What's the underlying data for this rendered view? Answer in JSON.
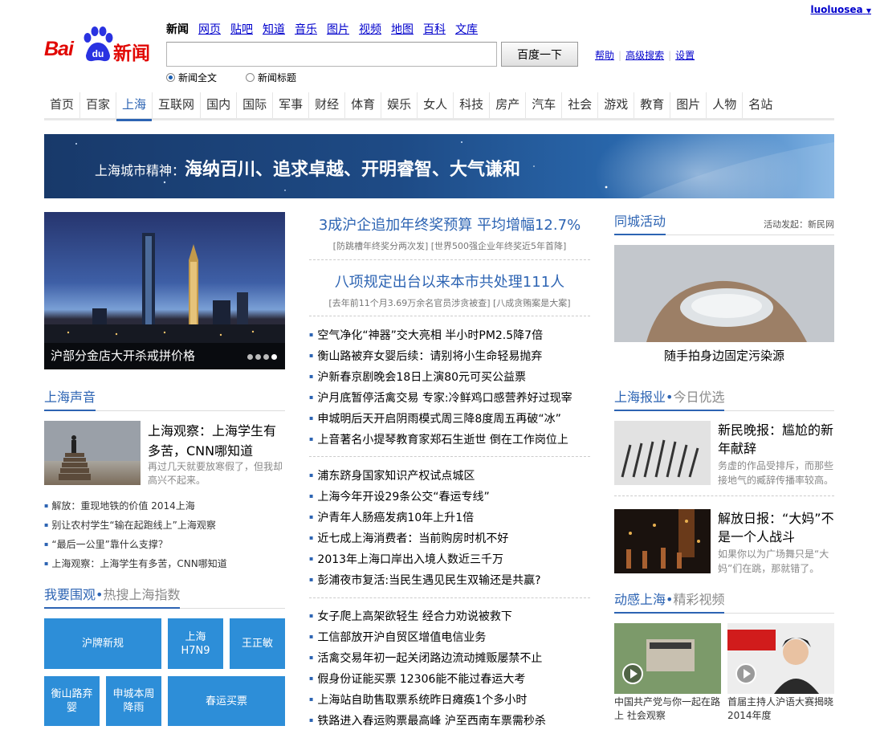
{
  "user": {
    "name": "luoluosea"
  },
  "logo": {
    "brand": "Bai",
    "du": "du",
    "product": "新闻"
  },
  "topnav": [
    "新闻",
    "网页",
    "贴吧",
    "知道",
    "音乐",
    "图片",
    "视频",
    "地图",
    "百科",
    "文库"
  ],
  "search": {
    "value": "",
    "button": "百度一下",
    "links": [
      "帮助",
      "高级搜索",
      "设置"
    ],
    "radios": [
      "新闻全文",
      "新闻标题"
    ]
  },
  "categories": [
    "首页",
    "百家",
    "上海",
    "互联网",
    "国内",
    "国际",
    "军事",
    "财经",
    "体育",
    "娱乐",
    "女人",
    "科技",
    "房产",
    "汽车",
    "社会",
    "游戏",
    "教育",
    "图片",
    "人物",
    "名站"
  ],
  "banner": {
    "small": "上海城市精神：",
    "big": "海纳百川、追求卓越、开明睿智、大气谦和"
  },
  "slider": {
    "caption": "沪部分金店大开杀戒拼价格"
  },
  "voice": {
    "title": "上海声音",
    "feature_title": "上海观察：上海学生有多苦，CNN哪知道",
    "feature_desc": "再过几天就要放寒假了，但我却高兴不起来。",
    "items": [
      "解放：重现地铁的价值 2014上海",
      "别让农村学生“输在起跑线上”上海观察",
      "“最后一公里”靠什么支撑？",
      "上海观察：上海学生有多苦，CNN哪知道"
    ]
  },
  "watch": {
    "title_a": "我要围观",
    "dot": "•",
    "title_b": "热搜上海指数",
    "tiles": [
      "沪牌新规",
      "上海H7N9",
      "王正敏",
      "衡山路弃婴",
      "申城本周降雨",
      "春运买票"
    ]
  },
  "main": {
    "h1": "3成沪企追加年终奖预算 平均增幅12.7%",
    "s1": "[防跳槽年终奖分两次发] [世界500强企业年终奖近5年首降]",
    "h2": "八项规定出台以来本市共处理111人",
    "s2": "[去年前11个月3.69万余名官员涉贪被查] [八成贪贿案是大案]",
    "list1": [
      "空气净化“神器”交大亮相 半小时PM2.5降7倍",
      "衡山路被弃女婴后续：请别将小生命轻易抛弃",
      "沪新春京剧晚会18日上演80元可买公益票",
      "沪月底暂停活禽交易 专家:冷鲜鸡口感营养好过现宰",
      "申城明后天开启阴雨模式周三降8度周五再破“冰”",
      "上音著名小提琴教育家郑石生逝世 倒在工作岗位上"
    ],
    "list2": [
      "浦东跻身国家知识产权试点城区",
      "上海今年开设29条公交“春运专线”",
      "沪青年人肠癌发病10年上升1倍",
      "近七成上海消费者：当前购房时机不好",
      "2013年上海口岸出入境人数近三千万",
      "彭浦夜市复活:当民生遇见民生双输还是共赢?"
    ],
    "list3": [
      "女子爬上高架欲轻生 经合力劝说被救下",
      "工信部放开沪自贸区增值电信业务",
      "活禽交易年初一起关闭路边流动摊贩屡禁不止",
      "假身份证能买票 12306能不能过春运大考",
      "上海站自助售取票系统昨日瘫痪1个多小时",
      "铁路进入春运购票最高峰 沪至西南车票需秒杀"
    ]
  },
  "right": {
    "activity_title": "同城活动",
    "activity_note": "活动发起：新民网",
    "activity_caption": "随手拍身边固定污染源",
    "papers_title_a": "上海报业",
    "papers_dot": "•",
    "papers_title_b": "今日优选",
    "paper1_title": "新民晚报：尴尬的新年献辞",
    "paper1_desc": "务虚的作品受排斥，而那些接地气的臧辞传播率较高。",
    "paper2_title": "解放日报：“大妈”不是一个人战斗",
    "paper2_desc": "如果你以为广场舞只是“大妈”们在跳，那就错了。",
    "video_title_a": "动感上海",
    "video_dot": "•",
    "video_title_b": "精彩视频",
    "video1": "中国共产党与你一起在路上 社会观察",
    "video2": "首届主持人沪语大赛揭晓 2014年度"
  }
}
